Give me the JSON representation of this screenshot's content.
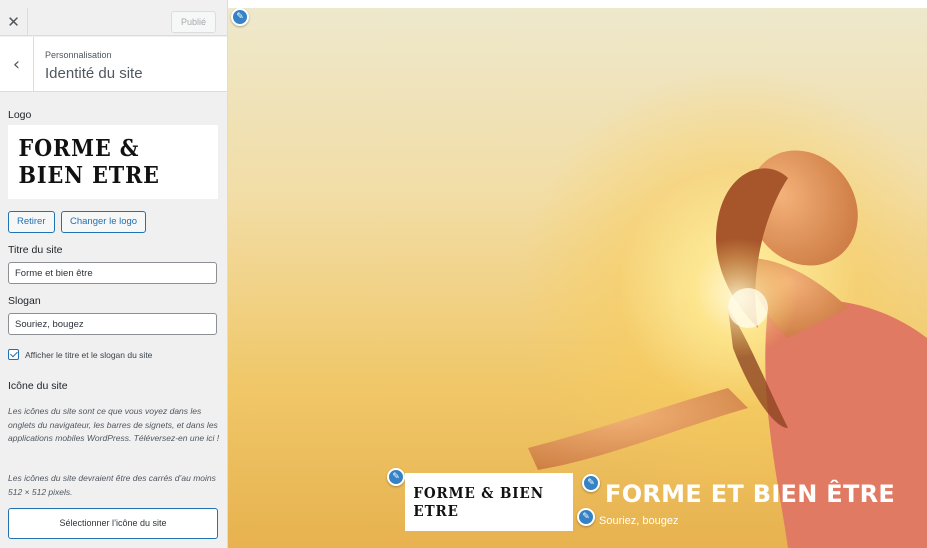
{
  "header": {
    "close_icon": "close-icon",
    "publish_label": "Publié"
  },
  "section": {
    "back_icon": "chevron-left-icon",
    "breadcrumb": "Personnalisation",
    "title": "Identité du site"
  },
  "logo": {
    "label": "Logo",
    "logo_text": "FORME & BIEN ETRE",
    "remove_label": "Retirer",
    "change_label": "Changer le logo"
  },
  "site_title_field": {
    "label": "Titre du site",
    "value": "Forme et bien être"
  },
  "tagline_field": {
    "label": "Slogan",
    "value": "Souriez, bougez"
  },
  "display_checkbox": {
    "label": "Afficher le titre et le slogan du site",
    "checked": true
  },
  "site_icon": {
    "heading": "Icône du site",
    "description": "Les icônes du site sont ce que vous voyez dans les onglets du navigateur, les barres de signets, et dans les applications mobiles WordPress. Téléversez-en une ici !",
    "size_note": "Les icônes du site devraient être des carrés d’au moins 512 × 512 pixels.",
    "select_label": "Sélectionner l’icône du site"
  },
  "preview": {
    "logo_text": "FORME & BIEN ETRE",
    "site_title": "FORME ET BIEN ÊTRE",
    "tagline": "Souriez, bougez",
    "edit_icon": "pencil-icon"
  },
  "colors": {
    "accent": "#2271b1",
    "edit_shortcut": "#3582c4",
    "sidebar_bg": "#f0f0f1"
  }
}
